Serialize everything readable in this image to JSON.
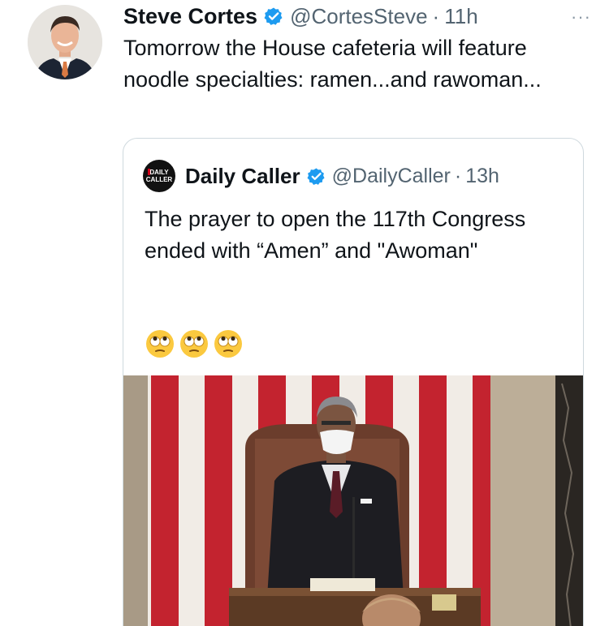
{
  "tweet": {
    "author_name": "Steve Cortes",
    "handle": "@CortesSteve",
    "separator": "·",
    "time": "11h",
    "more_label": "···",
    "text": "Tomorrow the House cafeteria will feature noodle specialties: ramen...and rawoman...",
    "avatar_icon": "person-avatar-icon"
  },
  "quoted_tweet": {
    "logo_text_line1": "DAILY",
    "logo_text_line2": "CALLER",
    "author_name": "Daily Caller",
    "handle": "@DailyCaller",
    "separator": "·",
    "time": "13h",
    "text": "The prayer to open the 117th Congress ended with “Amen” and \"Awoman\"",
    "emojis": [
      "face-with-rolling-eyes-icon",
      "face-with-rolling-eyes-icon",
      "face-with-rolling-eyes-icon"
    ],
    "media_icon": "house-chamber-photo"
  },
  "colors": {
    "verified_blue": "#1d9bf0",
    "text_primary": "#0f1419",
    "text_secondary": "#536471",
    "border": "#cfd9de"
  }
}
